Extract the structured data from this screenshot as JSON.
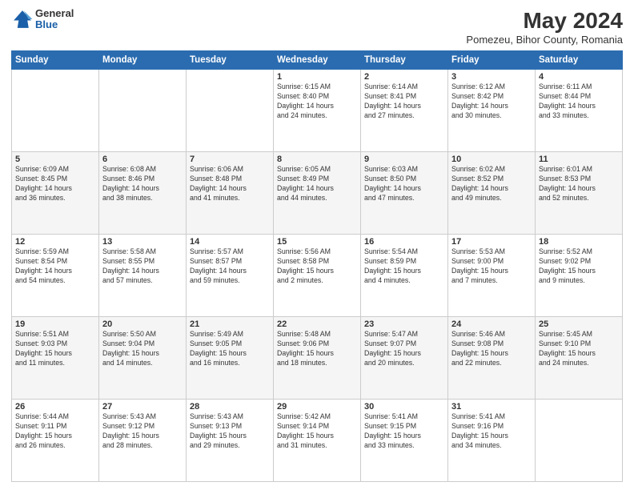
{
  "header": {
    "logo_general": "General",
    "logo_blue": "Blue",
    "month_year": "May 2024",
    "location": "Pomezeu, Bihor County, Romania"
  },
  "days_of_week": [
    "Sunday",
    "Monday",
    "Tuesday",
    "Wednesday",
    "Thursday",
    "Friday",
    "Saturday"
  ],
  "weeks": [
    [
      {
        "day": "",
        "text": ""
      },
      {
        "day": "",
        "text": ""
      },
      {
        "day": "",
        "text": ""
      },
      {
        "day": "1",
        "text": "Sunrise: 6:15 AM\nSunset: 8:40 PM\nDaylight: 14 hours\nand 24 minutes."
      },
      {
        "day": "2",
        "text": "Sunrise: 6:14 AM\nSunset: 8:41 PM\nDaylight: 14 hours\nand 27 minutes."
      },
      {
        "day": "3",
        "text": "Sunrise: 6:12 AM\nSunset: 8:42 PM\nDaylight: 14 hours\nand 30 minutes."
      },
      {
        "day": "4",
        "text": "Sunrise: 6:11 AM\nSunset: 8:44 PM\nDaylight: 14 hours\nand 33 minutes."
      }
    ],
    [
      {
        "day": "5",
        "text": "Sunrise: 6:09 AM\nSunset: 8:45 PM\nDaylight: 14 hours\nand 36 minutes."
      },
      {
        "day": "6",
        "text": "Sunrise: 6:08 AM\nSunset: 8:46 PM\nDaylight: 14 hours\nand 38 minutes."
      },
      {
        "day": "7",
        "text": "Sunrise: 6:06 AM\nSunset: 8:48 PM\nDaylight: 14 hours\nand 41 minutes."
      },
      {
        "day": "8",
        "text": "Sunrise: 6:05 AM\nSunset: 8:49 PM\nDaylight: 14 hours\nand 44 minutes."
      },
      {
        "day": "9",
        "text": "Sunrise: 6:03 AM\nSunset: 8:50 PM\nDaylight: 14 hours\nand 47 minutes."
      },
      {
        "day": "10",
        "text": "Sunrise: 6:02 AM\nSunset: 8:52 PM\nDaylight: 14 hours\nand 49 minutes."
      },
      {
        "day": "11",
        "text": "Sunrise: 6:01 AM\nSunset: 8:53 PM\nDaylight: 14 hours\nand 52 minutes."
      }
    ],
    [
      {
        "day": "12",
        "text": "Sunrise: 5:59 AM\nSunset: 8:54 PM\nDaylight: 14 hours\nand 54 minutes."
      },
      {
        "day": "13",
        "text": "Sunrise: 5:58 AM\nSunset: 8:55 PM\nDaylight: 14 hours\nand 57 minutes."
      },
      {
        "day": "14",
        "text": "Sunrise: 5:57 AM\nSunset: 8:57 PM\nDaylight: 14 hours\nand 59 minutes."
      },
      {
        "day": "15",
        "text": "Sunrise: 5:56 AM\nSunset: 8:58 PM\nDaylight: 15 hours\nand 2 minutes."
      },
      {
        "day": "16",
        "text": "Sunrise: 5:54 AM\nSunset: 8:59 PM\nDaylight: 15 hours\nand 4 minutes."
      },
      {
        "day": "17",
        "text": "Sunrise: 5:53 AM\nSunset: 9:00 PM\nDaylight: 15 hours\nand 7 minutes."
      },
      {
        "day": "18",
        "text": "Sunrise: 5:52 AM\nSunset: 9:02 PM\nDaylight: 15 hours\nand 9 minutes."
      }
    ],
    [
      {
        "day": "19",
        "text": "Sunrise: 5:51 AM\nSunset: 9:03 PM\nDaylight: 15 hours\nand 11 minutes."
      },
      {
        "day": "20",
        "text": "Sunrise: 5:50 AM\nSunset: 9:04 PM\nDaylight: 15 hours\nand 14 minutes."
      },
      {
        "day": "21",
        "text": "Sunrise: 5:49 AM\nSunset: 9:05 PM\nDaylight: 15 hours\nand 16 minutes."
      },
      {
        "day": "22",
        "text": "Sunrise: 5:48 AM\nSunset: 9:06 PM\nDaylight: 15 hours\nand 18 minutes."
      },
      {
        "day": "23",
        "text": "Sunrise: 5:47 AM\nSunset: 9:07 PM\nDaylight: 15 hours\nand 20 minutes."
      },
      {
        "day": "24",
        "text": "Sunrise: 5:46 AM\nSunset: 9:08 PM\nDaylight: 15 hours\nand 22 minutes."
      },
      {
        "day": "25",
        "text": "Sunrise: 5:45 AM\nSunset: 9:10 PM\nDaylight: 15 hours\nand 24 minutes."
      }
    ],
    [
      {
        "day": "26",
        "text": "Sunrise: 5:44 AM\nSunset: 9:11 PM\nDaylight: 15 hours\nand 26 minutes."
      },
      {
        "day": "27",
        "text": "Sunrise: 5:43 AM\nSunset: 9:12 PM\nDaylight: 15 hours\nand 28 minutes."
      },
      {
        "day": "28",
        "text": "Sunrise: 5:43 AM\nSunset: 9:13 PM\nDaylight: 15 hours\nand 29 minutes."
      },
      {
        "day": "29",
        "text": "Sunrise: 5:42 AM\nSunset: 9:14 PM\nDaylight: 15 hours\nand 31 minutes."
      },
      {
        "day": "30",
        "text": "Sunrise: 5:41 AM\nSunset: 9:15 PM\nDaylight: 15 hours\nand 33 minutes."
      },
      {
        "day": "31",
        "text": "Sunrise: 5:41 AM\nSunset: 9:16 PM\nDaylight: 15 hours\nand 34 minutes."
      },
      {
        "day": "",
        "text": ""
      }
    ]
  ]
}
